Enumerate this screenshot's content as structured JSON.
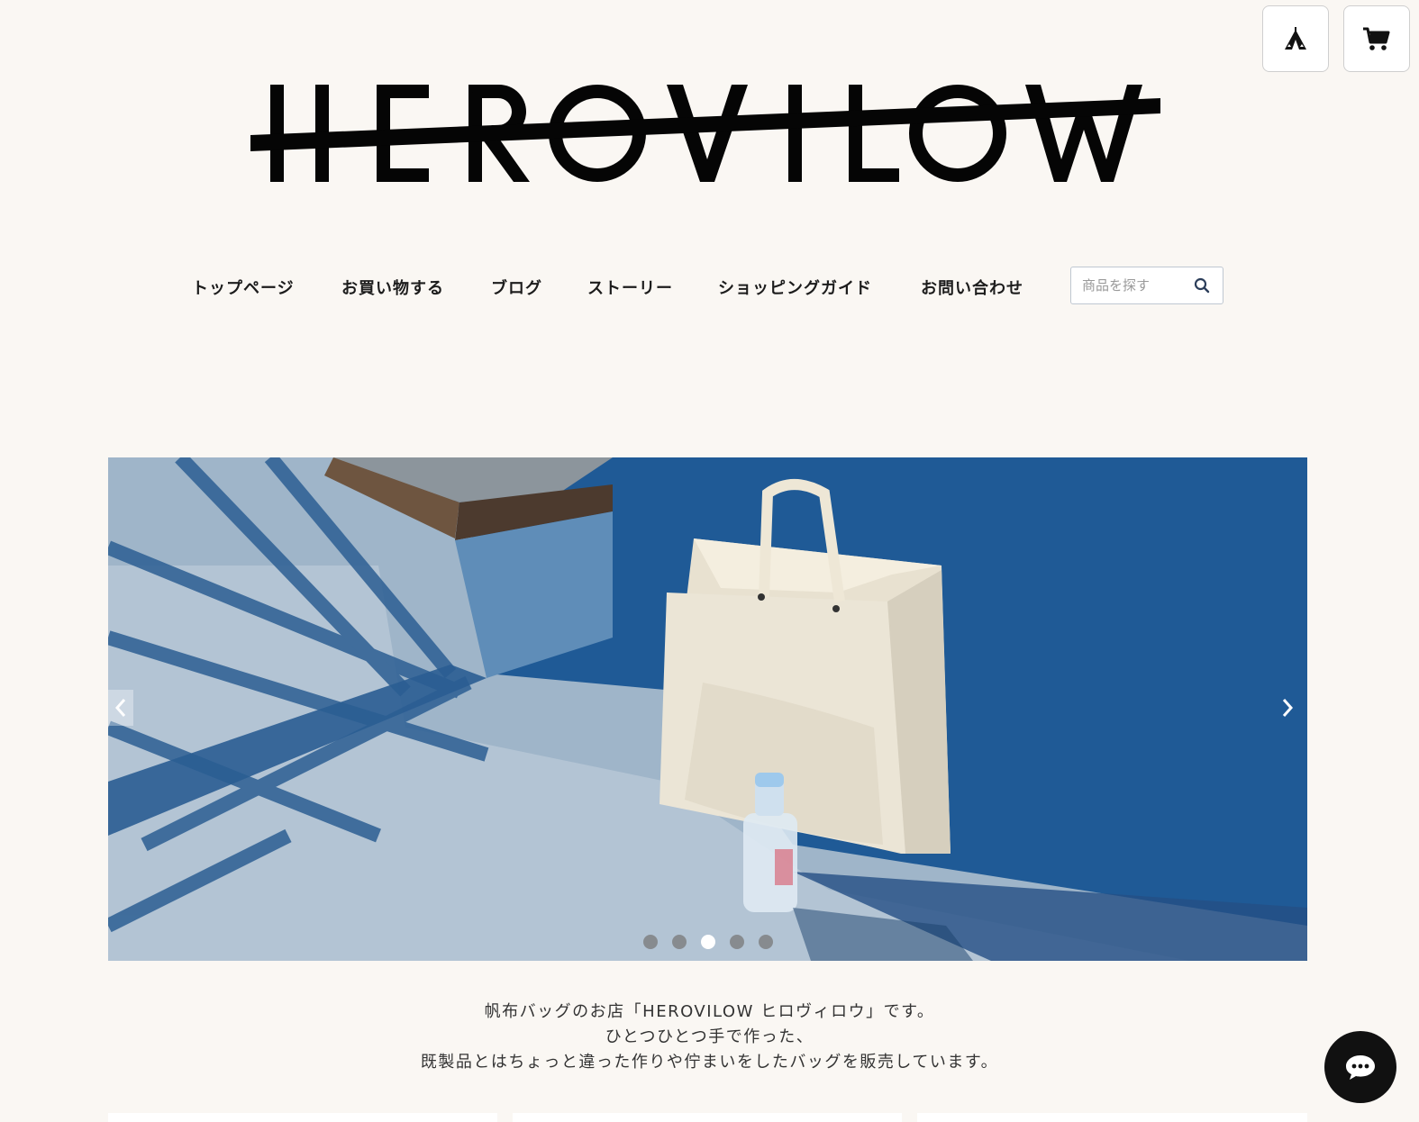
{
  "header": {
    "logo_text": "HEROVILOW",
    "tent_button_icon": "tent-icon",
    "cart_button_icon": "cart-icon"
  },
  "nav": {
    "items": [
      {
        "label": "トップページ"
      },
      {
        "label": "お買い物する"
      },
      {
        "label": "ブログ"
      },
      {
        "label": "ストーリー"
      },
      {
        "label": "ショッピングガイド"
      },
      {
        "label": "お問い合わせ"
      }
    ],
    "search": {
      "placeholder": "商品を探す",
      "value": "",
      "icon": "search-icon"
    }
  },
  "hero": {
    "slides_count": 5,
    "active_slide": 3,
    "prev_icon": "chevron-left-icon",
    "next_icon": "chevron-right-icon",
    "image_subject": "canvas tote bag with water bottle on concrete"
  },
  "intro": {
    "line1": "帆布バッグのお店「HEROVILOW ヒロヴィロウ」です。",
    "line2": "ひとつひとつ手で作った、",
    "line3": "既製品とはちょっと違った作りや佇まいをしたバッグを販売しています。"
  },
  "chat": {
    "icon": "chat-bubble-icon"
  },
  "colors": {
    "background": "#faf7f3",
    "text": "#222222",
    "chat_button": "#111111"
  }
}
